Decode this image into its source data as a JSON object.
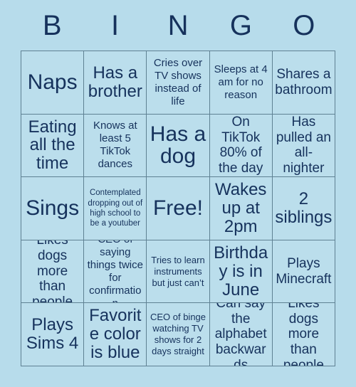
{
  "card": {
    "title": "BINGO",
    "header_letters": [
      "B",
      "I",
      "N",
      "G",
      "O"
    ],
    "colors": {
      "page_background": "#b7dceb",
      "cell_background": "#bbdeec",
      "text": "#16325c",
      "grid_line": "#5f8193"
    },
    "free_space_label": "Free!",
    "free_space_position": "row3-col3",
    "rows": [
      {
        "cells": [
          {
            "text": "Naps",
            "size": "xl"
          },
          {
            "text": "Has a brother",
            "size": "lg"
          },
          {
            "text": "Cries over TV shows instead of life",
            "size": "sm"
          },
          {
            "text": "Sleeps at 4 am for no reason",
            "size": "sm"
          },
          {
            "text": "Shares a bathroom",
            "size": "md"
          }
        ]
      },
      {
        "cells": [
          {
            "text": "Eating all the time",
            "size": "lg"
          },
          {
            "text": "Knows at least 5 TikTok dances",
            "size": "sm"
          },
          {
            "text": "Has a dog",
            "size": "xl"
          },
          {
            "text": "On TikTok 80% of the day",
            "size": "md"
          },
          {
            "text": "Has pulled an all-nighter",
            "size": "md"
          }
        ]
      },
      {
        "cells": [
          {
            "text": "Sings",
            "size": "xl"
          },
          {
            "text": "Contemplated dropping out of high school to be a youtuber",
            "size": "xxs"
          },
          {
            "text": "Free!",
            "size": "xl"
          },
          {
            "text": "Wakes up at 2pm",
            "size": "lg"
          },
          {
            "text": "2 siblings",
            "size": "lg"
          }
        ]
      },
      {
        "cells": [
          {
            "text": "Likes dogs more than people",
            "size": "md"
          },
          {
            "text": "CEO of saying things twice for confirmation",
            "size": "sm"
          },
          {
            "text": "Tries to learn instruments but just can’t",
            "size": "xs"
          },
          {
            "text": "Birthday is in June",
            "size": "lg"
          },
          {
            "text": "Plays Minecraft",
            "size": "md"
          }
        ]
      },
      {
        "cells": [
          {
            "text": "Plays Sims 4",
            "size": "lg"
          },
          {
            "text": "Favorite color is blue",
            "size": "lg"
          },
          {
            "text": "CEO of binge watching TV shows for 2 days straight",
            "size": "xs"
          },
          {
            "text": "Can say the alphabet backwards",
            "size": "md"
          },
          {
            "text": "Likes dogs more than people",
            "size": "md"
          }
        ]
      }
    ]
  }
}
